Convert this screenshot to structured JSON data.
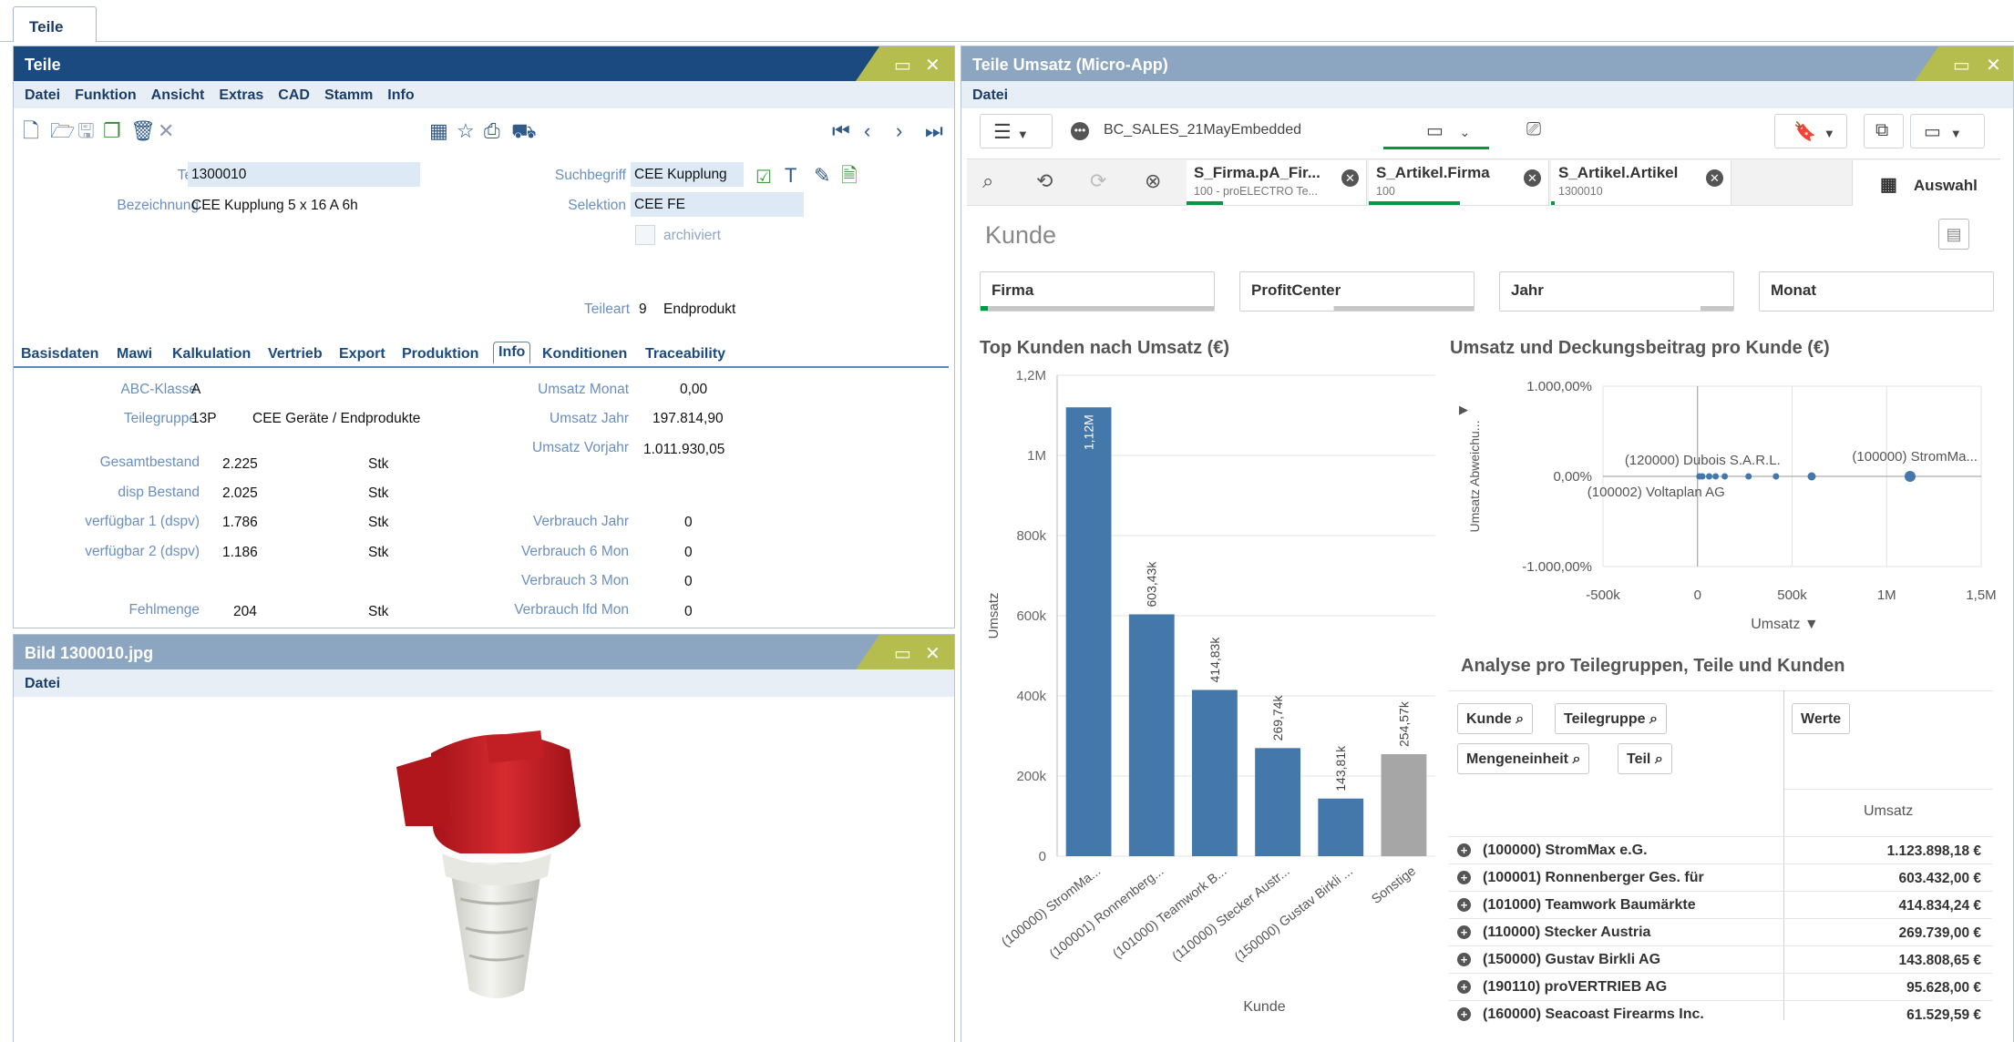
{
  "workspace_tab": "Teile",
  "teile": {
    "title": "Teile",
    "menu": [
      "Datei",
      "Funktion",
      "Ansicht",
      "Extras",
      "CAD",
      "Stamm",
      "Info"
    ],
    "teil_label": "Teil",
    "teil_value": "1300010",
    "bez_label": "Bezeichnung",
    "bez_value": "CEE Kupplung 5 x 16 A 6h",
    "such_label": "Suchbegriff",
    "such_value": "CEE Kupplung",
    "sel_label": "Selektion",
    "sel_value": "CEE FE",
    "archiviert": "archiviert",
    "teileart_label": "Teileart",
    "teileart_num": "9",
    "teileart_value": "Endprodukt",
    "tabs": [
      "Basisdaten",
      "Mawi",
      "Kalkulation",
      "Vertrieb",
      "Export",
      "Produktion",
      "Info",
      "Konditionen",
      "Traceability"
    ],
    "abc_label": "ABC-Klasse",
    "abc_value": "A",
    "tg_label": "Teilegruppe",
    "tg_code": "13P",
    "tg_name": "CEE Geräte / Endprodukte",
    "stock": [
      {
        "label": "Gesamtbestand",
        "value": "2.225",
        "unit": "Stk"
      },
      {
        "label": "disp Bestand",
        "value": "2.025",
        "unit": "Stk"
      },
      {
        "label": "verfügbar 1 (dspv)",
        "value": "1.786",
        "unit": "Stk"
      },
      {
        "label": "verfügbar 2 (dspv)",
        "value": "1.186",
        "unit": "Stk"
      },
      {
        "label": "Fehlmenge",
        "value": "204",
        "unit": "Stk"
      }
    ],
    "right_fields": [
      {
        "label": "Umsatz Monat",
        "value": "0,00"
      },
      {
        "label": "Umsatz Jahr",
        "value": "197.814,90"
      },
      {
        "label": "Umsatz Vorjahr",
        "value": "1.011.930,05"
      },
      {
        "label": "Verbrauch Jahr",
        "value": "0"
      },
      {
        "label": "Verbrauch 6 Mon",
        "value": "0"
      },
      {
        "label": "Verbrauch 3 Mon",
        "value": "0"
      },
      {
        "label": "Verbrauch lfd Mon",
        "value": "0"
      }
    ]
  },
  "bild": {
    "title": "Bild 1300010.jpg",
    "menu": [
      "Datei"
    ]
  },
  "micro": {
    "title": "Teile Umsatz (Micro-App)",
    "menu": [
      "Datei"
    ],
    "app_name": "BC_SALES_21MayEmbedded",
    "selections": [
      {
        "title": "S_Firma.pA_Fir...",
        "sub": "100 - proELECTRO Te..."
      },
      {
        "title": "S_Artikel.Firma",
        "sub": "100"
      },
      {
        "title": "S_Artikel.Artikel",
        "sub": "1300010"
      }
    ],
    "auswahl": "Auswahl",
    "sheet_title": "Kunde",
    "filters": [
      "Firma",
      "ProfitCenter",
      "Jahr",
      "Monat"
    ],
    "bar_title": "Top Kunden nach Umsatz (€)",
    "scatter_title": "Umsatz und Deckungsbeitrag pro Kunde (€)",
    "table_title": "Analyse pro Teilegruppen, Teile und Kunden",
    "dims": [
      "Kunde",
      "Teilegruppe",
      "Mengeneinheit",
      "Teil"
    ],
    "werte": "Werte",
    "col_umsatz": "Umsatz",
    "rows": [
      {
        "name": "(100000) StromMax e.G.",
        "value": "1.123.898,18 €"
      },
      {
        "name": "(100001) Ronnenberger Ges. für",
        "value": "603.432,00 €"
      },
      {
        "name": "(101000) Teamwork Baumärkte",
        "value": "414.834,24 €"
      },
      {
        "name": "(110000) Stecker Austria",
        "value": "269.739,00 €"
      },
      {
        "name": "(150000) Gustav Birkli AG",
        "value": "143.808,65 €"
      },
      {
        "name": "(190110) proVERTRIEB AG",
        "value": "95.628,00 €"
      },
      {
        "name": "(160000) Seacoast Firearms Inc.",
        "value": "61.529,59 €"
      }
    ]
  },
  "chart_data": [
    {
      "type": "bar",
      "title": "Top Kunden nach Umsatz (€)",
      "xlabel": "Kunde",
      "ylabel": "Umsatz",
      "categories": [
        "(100000) StromMa...",
        "(100001) Ronnenberg...",
        "(101000) Teamwork B...",
        "(110000) Stecker Austr...",
        "(150000) Gustav Birkli ...",
        "Sonstige"
      ],
      "values": [
        1120000,
        603430,
        414830,
        269740,
        143810,
        254570
      ],
      "labels": [
        "1,12M",
        "603,43k",
        "414,83k",
        "269,74k",
        "143,81k",
        "254,57k"
      ],
      "colors": [
        "#4477aa",
        "#4477aa",
        "#4477aa",
        "#4477aa",
        "#4477aa",
        "#a6a6a6"
      ],
      "ylim": [
        0,
        1200000
      ],
      "yticks": [
        0,
        200000,
        400000,
        600000,
        800000,
        1000000,
        1200000
      ],
      "ytick_labels": [
        "0",
        "200k",
        "400k",
        "600k",
        "800k",
        "1M",
        "1,2M"
      ],
      "grid": true
    },
    {
      "type": "scatter",
      "title": "Umsatz und Deckungsbeitrag pro Kunde (€)",
      "xlabel": "Umsatz",
      "ylabel": "Umsatz Abweichu...",
      "xlim": [
        -500000,
        1500000
      ],
      "ylim": [
        -1000,
        1000
      ],
      "xticks": [
        -500000,
        0,
        500000,
        1000000,
        1500000
      ],
      "xtick_labels": [
        "-500k",
        "0",
        "500k",
        "1M",
        "1,5M"
      ],
      "yticks": [
        -1000,
        0,
        1000
      ],
      "ytick_labels": [
        "-1.000,00%",
        "0,00%",
        "1.000,00%"
      ],
      "points": [
        {
          "x": 1123898,
          "y": 0,
          "label": "(100000) StromMa..."
        },
        {
          "x": 603432,
          "y": 0
        },
        {
          "x": 414834,
          "y": 0
        },
        {
          "x": 269739,
          "y": 0
        },
        {
          "x": 143808,
          "y": 0
        },
        {
          "x": 95628,
          "y": 0
        },
        {
          "x": 61529,
          "y": 0
        },
        {
          "x": 25000,
          "y": 0,
          "label": "(120000) Dubois S.A.R.L."
        },
        {
          "x": 10000,
          "y": 0,
          "label": "(100002) Voltaplan AG"
        }
      ],
      "grid": true
    }
  ]
}
